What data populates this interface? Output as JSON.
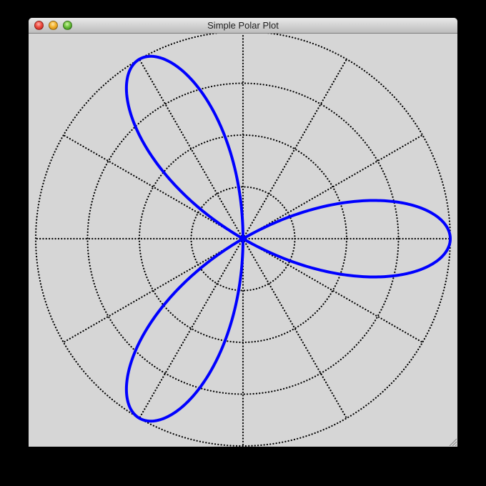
{
  "window": {
    "title": "Simple Polar Plot"
  },
  "colors": {
    "background": "#d6d6d6",
    "curve": "#0000ff",
    "grid": "#000000"
  },
  "icons": {
    "close": "close-button-icon",
    "minimize": "minimize-button-icon",
    "zoom": "zoom-button-icon",
    "resize": "resize-grip-icon"
  },
  "chart_data": {
    "type": "line",
    "coordinate_system": "polar",
    "title": "",
    "series": [
      {
        "equation": "r = cos(3θ)",
        "theta_range_degrees": [
          0,
          180
        ],
        "color": "#0000ff"
      }
    ],
    "r_axis": {
      "rlim": [
        0,
        1
      ],
      "gridline_rings": [
        0.25,
        0.5,
        0.75,
        1.0
      ],
      "tick_labels": []
    },
    "theta_axis": {
      "spoke_angles_degrees": [
        0,
        30,
        60,
        90,
        120,
        150,
        180,
        210,
        240,
        270,
        300,
        330
      ],
      "tick_labels": []
    },
    "grid": true,
    "grid_style": "dotted",
    "legend": "none"
  }
}
